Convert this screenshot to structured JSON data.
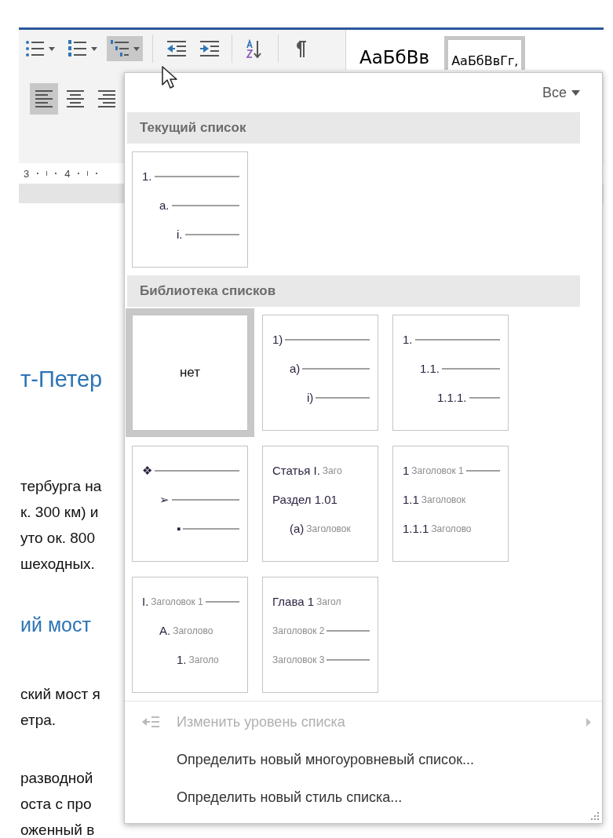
{
  "ribbon": {
    "buttons": [
      {
        "kind": "bullets",
        "selected": false,
        "dropdown": true
      },
      {
        "kind": "numbering",
        "selected": false,
        "dropdown": true
      },
      {
        "kind": "multilevel",
        "selected": true,
        "dropdown": true
      },
      {
        "kind": "outdent",
        "selected": false,
        "dropdown": false
      },
      {
        "kind": "indent",
        "selected": false,
        "dropdown": false
      },
      {
        "kind": "sort",
        "selected": false,
        "dropdown": false
      },
      {
        "kind": "pilcrow",
        "selected": false,
        "dropdown": false
      }
    ],
    "align": [
      {
        "kind": "left",
        "selected": true
      },
      {
        "kind": "center",
        "selected": false
      },
      {
        "kind": "right",
        "selected": false
      }
    ],
    "styles": [
      {
        "sample": "АаБбВв",
        "selected": false
      },
      {
        "sample": "АаБбВвГг,",
        "selected": true
      }
    ],
    "ruler": [
      "3",
      "4"
    ]
  },
  "document": {
    "paragraphs": [
      {
        "kind": "heading",
        "lines": [
          "т-Петер"
        ]
      },
      {
        "kind": "body",
        "lines": [
          "тербурга на",
          "к. 300 км) и",
          "уто ок. 800",
          "шеходных."
        ]
      },
      {
        "kind": "heading",
        "lines": [
          "ий мост"
        ]
      },
      {
        "kind": "body",
        "lines": [
          "ский мост я",
          "етра."
        ]
      },
      {
        "kind": "body",
        "lines": [
          "разводной",
          "оста с про",
          "оженный в"
        ]
      }
    ]
  },
  "menu": {
    "filter": "Все",
    "sections": [
      {
        "title": "Текущий список",
        "tiles": [
          {
            "kind": "sample",
            "selected": false,
            "rows": [
              {
                "marker": "1.",
                "rule": true,
                "children": [
                  {
                    "marker": "a.",
                    "rule": true,
                    "children": [
                      {
                        "marker": "i.",
                        "rule": true
                      }
                    ]
                  }
                ]
              }
            ]
          }
        ]
      },
      {
        "title": "Библиотека списков",
        "tiles": [
          {
            "kind": "none",
            "selected": true,
            "text": "нет"
          },
          {
            "kind": "sample",
            "selected": false,
            "rows": [
              {
                "marker": "1)",
                "rule": true,
                "children": [
                  {
                    "marker": "a)",
                    "rule": true,
                    "children": [
                      {
                        "marker": "i)",
                        "rule": true
                      }
                    ]
                  }
                ]
              }
            ]
          },
          {
            "kind": "sample",
            "selected": false,
            "rows": [
              {
                "marker": "1.",
                "rule": true,
                "children": [
                  {
                    "marker": "1.1.",
                    "rule": true,
                    "children": [
                      {
                        "marker": "1.1.1.",
                        "rule": true
                      }
                    ]
                  }
                ]
              }
            ]
          },
          {
            "kind": "sample",
            "selected": false,
            "rows": [
              {
                "marker": "❖",
                "rule": true,
                "children": [
                  {
                    "marker": "➢",
                    "rule": true,
                    "children": [
                      {
                        "marker": "▪",
                        "rule": true
                      }
                    ]
                  }
                ]
              }
            ]
          },
          {
            "kind": "sample",
            "selected": false,
            "rows": [
              {
                "marker": "Статья I.",
                "caption": "Заго",
                "rule": false
              },
              {
                "marker": "Раздел 1.01",
                "rule": false,
                "children": [
                  {
                    "marker": "(a)",
                    "caption": "Заголовок",
                    "rule": false
                  }
                ]
              }
            ]
          },
          {
            "kind": "sample",
            "selected": false,
            "rows": [
              {
                "marker": "1",
                "caption": "Заголовок 1",
                "rule": true
              },
              {
                "marker": "1.1",
                "caption": "Заголовок",
                "rule": false
              },
              {
                "marker": "1.1.1",
                "caption": "Заголово",
                "rule": false
              }
            ]
          },
          {
            "kind": "sample",
            "selected": false,
            "rows": [
              {
                "marker": "I.",
                "caption": "Заголовок 1",
                "rule": true,
                "children": [
                  {
                    "marker": "A.",
                    "caption": "Заголово",
                    "rule": false,
                    "children": [
                      {
                        "marker": "1.",
                        "caption": "Заголо",
                        "rule": false
                      }
                    ]
                  }
                ]
              }
            ]
          },
          {
            "kind": "sample",
            "selected": false,
            "rows": [
              {
                "marker": "Глава 1",
                "caption": "Загол",
                "rule": false
              },
              {
                "caption": "Заголовок 2",
                "rule": true
              },
              {
                "caption": "Заголовок 3",
                "rule": true
              }
            ]
          }
        ]
      }
    ],
    "commands": [
      {
        "label": "Изменить уровень списка",
        "disabled": true,
        "icon": true,
        "submenu": true
      },
      {
        "label": "Определить новый многоуровневый список...",
        "disabled": false,
        "icon": false,
        "submenu": false
      },
      {
        "label": "Определить новый стиль списка...",
        "disabled": false,
        "icon": false,
        "submenu": false
      }
    ]
  }
}
